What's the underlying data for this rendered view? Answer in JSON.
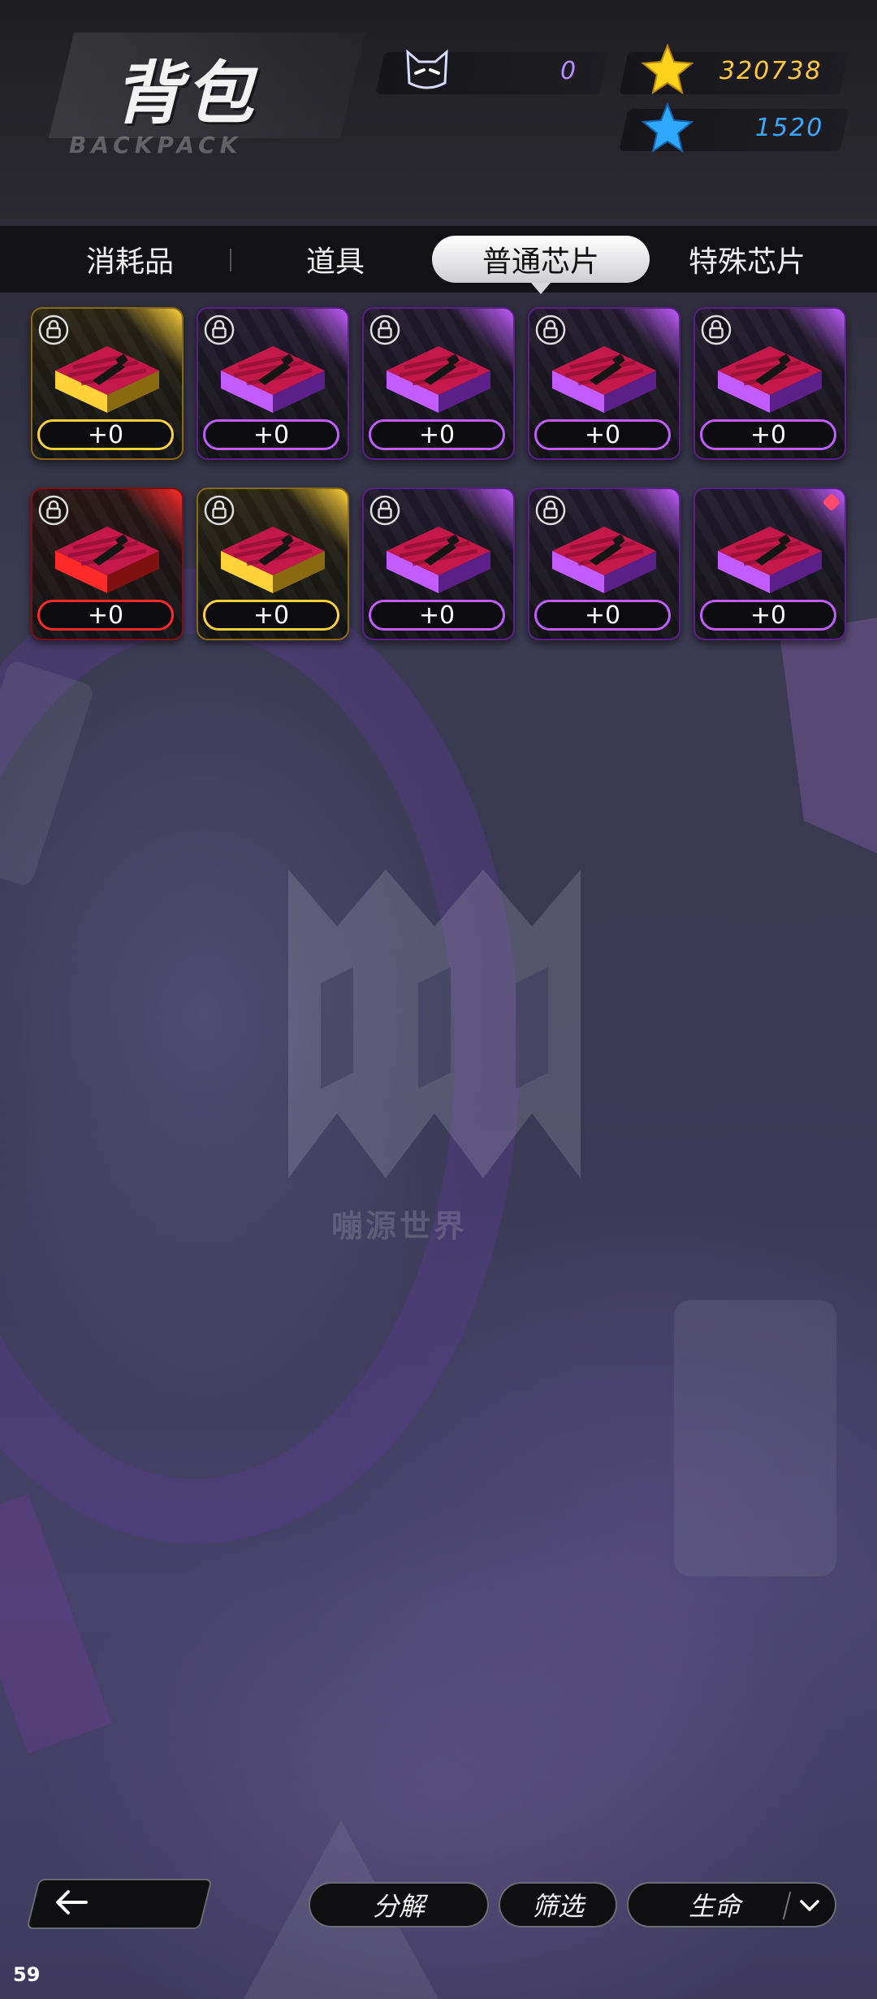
{
  "header": {
    "title": "背包",
    "subtitle": "BACKPACK",
    "currencies": [
      {
        "icon": "cat-mask-icon",
        "value": "0",
        "color": "#b58cff"
      },
      {
        "icon": "gold-star-icon",
        "value": "320738",
        "color": "#ffc93a"
      },
      {
        "icon": "blue-star-icon",
        "value": "1520",
        "color": "#3aa8ff"
      }
    ]
  },
  "tabs": [
    {
      "label": "消耗品",
      "active": false
    },
    {
      "label": "道具",
      "active": false
    },
    {
      "label": "普通芯片",
      "active": true
    },
    {
      "label": "特殊芯片",
      "active": false
    }
  ],
  "items": [
    {
      "rarity": "gold",
      "plus": "+0",
      "locked": true
    },
    {
      "rarity": "purple",
      "plus": "+0",
      "locked": true
    },
    {
      "rarity": "purple",
      "plus": "+0",
      "locked": true
    },
    {
      "rarity": "purple",
      "plus": "+0",
      "locked": true
    },
    {
      "rarity": "purple",
      "plus": "+0",
      "locked": true
    },
    {
      "rarity": "red",
      "plus": "+0",
      "locked": true
    },
    {
      "rarity": "gold",
      "plus": "+0",
      "locked": true
    },
    {
      "rarity": "purple",
      "plus": "+0",
      "locked": true
    },
    {
      "rarity": "purple",
      "plus": "+0",
      "locked": true
    },
    {
      "rarity": "purple",
      "plus": "+0",
      "locked": false,
      "new": true
    }
  ],
  "rarity_colors": {
    "gold": {
      "edge": "#ffd23a",
      "dark": "#8a6a10",
      "bg": "#2a2414"
    },
    "purple": {
      "edge": "#c25cff",
      "dark": "#5a1f88",
      "bg": "#211a2c"
    },
    "red": {
      "edge": "#ff2a2a",
      "dark": "#801010",
      "bg": "#2a1616"
    }
  },
  "watermark": {
    "text": "嘣源世界"
  },
  "bottom": {
    "decompose_label": "分解",
    "filter_label": "筛选",
    "attribute_label": "生命"
  },
  "fps": "59"
}
